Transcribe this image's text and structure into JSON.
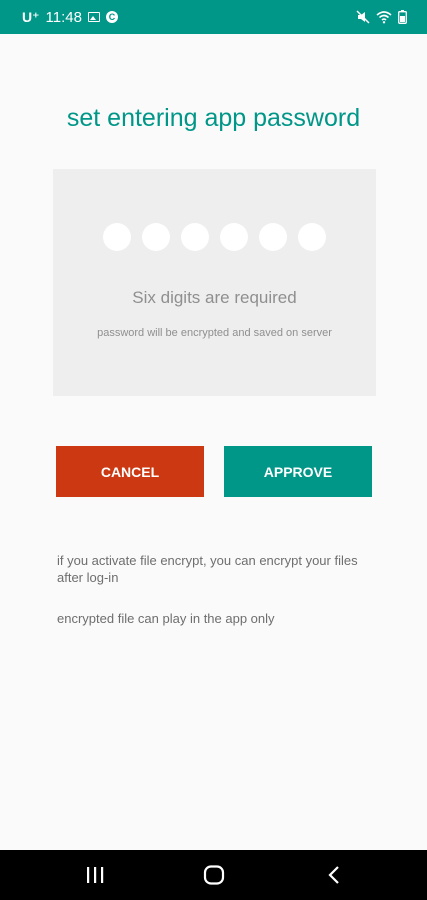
{
  "status_bar": {
    "carrier": "U⁺",
    "time": "11:48",
    "icons": [
      "image-notification-icon",
      "c-notification-icon",
      "mute-icon",
      "wifi-icon",
      "battery-icon"
    ]
  },
  "title": "set entering app password",
  "pin": {
    "digit_count": 6,
    "requirement": "Six digits are required",
    "encryption_note": "password will be encrypted and saved on server"
  },
  "buttons": {
    "cancel_label": "CANCEL",
    "approve_label": "APPROVE"
  },
  "info": {
    "line1": "if you activate file encrypt, you can encrypt your files after log-in",
    "line2": "encrypted file can play in the app only"
  },
  "nav": {
    "icons": [
      "recent-apps-icon",
      "home-icon",
      "back-icon"
    ]
  },
  "colors": {
    "accent": "#009688",
    "cancel": "#cc3811",
    "panel": "#eeeeee",
    "background": "#fafafa"
  }
}
